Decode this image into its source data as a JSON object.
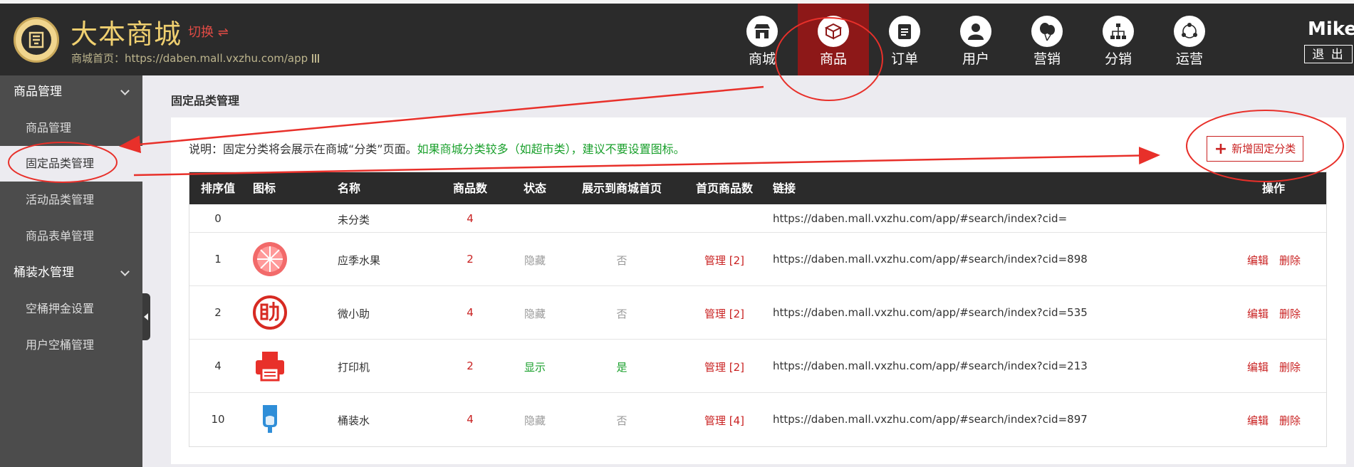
{
  "header": {
    "brand": "大本商城",
    "switch_label": "切换 ⇌",
    "home_url": "商城首页：https://daben.mall.vxzhu.com/app",
    "user_name": "Mike",
    "logout_label": "退 出",
    "nav": [
      {
        "label": "商城",
        "icon": "store-icon",
        "active": false
      },
      {
        "label": "商品",
        "icon": "box-icon",
        "active": true
      },
      {
        "label": "订单",
        "icon": "clipboard-icon",
        "active": false
      },
      {
        "label": "用户",
        "icon": "user-icon",
        "active": false
      },
      {
        "label": "营销",
        "icon": "balloon-icon",
        "active": false
      },
      {
        "label": "分销",
        "icon": "hierarchy-icon",
        "active": false
      },
      {
        "label": "运营",
        "icon": "share-icon",
        "active": false
      }
    ]
  },
  "sidebar": {
    "groups": [
      {
        "label": "商品管理",
        "items": [
          {
            "label": "商品管理",
            "active": false
          },
          {
            "label": "固定品类管理",
            "active": true
          },
          {
            "label": "活动品类管理",
            "active": false
          },
          {
            "label": "商品表单管理",
            "active": false
          }
        ]
      },
      {
        "label": "桶装水管理",
        "items": [
          {
            "label": "空桶押金设置",
            "active": false
          },
          {
            "label": "用户空桶管理",
            "active": false
          }
        ]
      }
    ]
  },
  "main": {
    "title": "固定品类管理",
    "note_prefix": "说明：固定分类将会展示在商城“分类”页面。",
    "note_green": "如果商城分类较多（如超市类），建议不要设置图标。",
    "add_button": "新增固定分类",
    "columns": [
      "排序值",
      "图标",
      "名称",
      "商品数",
      "状态",
      "展示到商城首页",
      "首页商品数",
      "链接",
      "操作"
    ],
    "rows": [
      {
        "sort": "0",
        "icon": "",
        "name": "未分类",
        "count": "4",
        "status": "",
        "show_home": "",
        "home_count": "",
        "link": "https://daben.mall.vxzhu.com/app/#search/index?cid=",
        "edit": "",
        "delete": ""
      },
      {
        "sort": "1",
        "icon": "grapefruit-icon",
        "name": "应季水果",
        "count": "2",
        "status": "隐藏",
        "show_home": "否",
        "home_count": "管理 [2]",
        "link": "https://daben.mall.vxzhu.com/app/#search/index?cid=898",
        "edit": "编辑",
        "delete": "删除"
      },
      {
        "sort": "2",
        "icon": "helper-icon",
        "name": "微小助",
        "count": "4",
        "status": "隐藏",
        "show_home": "否",
        "home_count": "管理 [2]",
        "link": "https://daben.mall.vxzhu.com/app/#search/index?cid=535",
        "edit": "编辑",
        "delete": "删除"
      },
      {
        "sort": "4",
        "icon": "printer-icon",
        "name": "打印机",
        "count": "2",
        "status": "显示",
        "show_home": "是",
        "home_count": "管理 [2]",
        "link": "https://daben.mall.vxzhu.com/app/#search/index?cid=213",
        "edit": "编辑",
        "delete": "删除"
      },
      {
        "sort": "10",
        "icon": "water-bottle-icon",
        "name": "桶装水",
        "count": "4",
        "status": "隐藏",
        "show_home": "否",
        "home_count": "管理 [4]",
        "link": "https://daben.mall.vxzhu.com/app/#search/index?cid=897",
        "edit": "编辑",
        "delete": "删除"
      }
    ]
  },
  "colors": {
    "header_bg": "#2b2b2b",
    "active_nav": "#8d1818",
    "brand_gold": "#f0d070",
    "accent_red": "#c92121",
    "status_green": "#1aa02c",
    "annotation_red": "#e8302a"
  }
}
